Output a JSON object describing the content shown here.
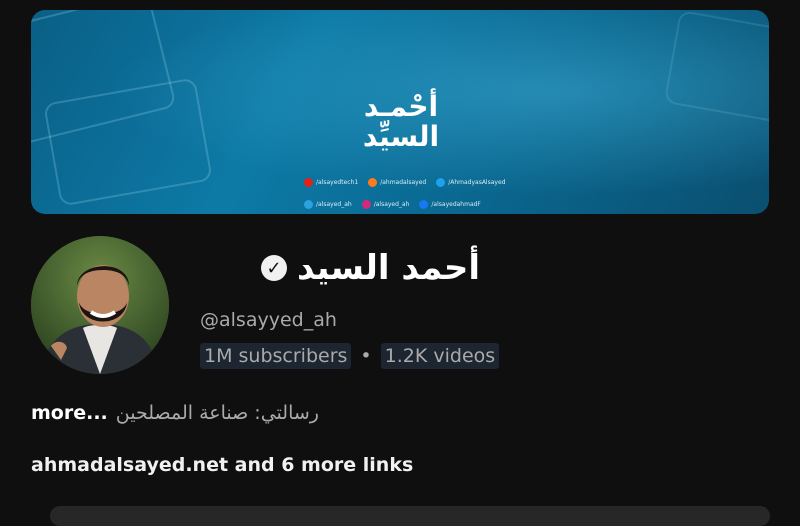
{
  "banner": {
    "title_line1": "أحْمـد",
    "title_line2": "السيِّد",
    "links": [
      {
        "icon": "youtube-icon",
        "color": "#e62117",
        "label": "/alsayedtech1"
      },
      {
        "icon": "soundcloud-icon",
        "color": "#ff7a1a",
        "label": "/ahmadalsayed"
      },
      {
        "icon": "twitter-icon",
        "color": "#1da1f2",
        "label": "/AhmadyasAlsayed"
      },
      {
        "icon": "telegram-icon",
        "color": "#2aa3de",
        "label": "/alsayed_ah"
      },
      {
        "icon": "instagram-icon",
        "color": "#d6287a",
        "label": "/alsayed_ah"
      },
      {
        "icon": "facebook-icon",
        "color": "#1877f2",
        "label": "/alsayedahmadF"
      }
    ]
  },
  "channel": {
    "name": "أحمد السيد",
    "handle": "@alsayyed_ah",
    "subscribers": "1M subscribers",
    "separator": "•",
    "videos": "1.2K videos",
    "description": "رسالتي: صناعة المصلحين",
    "more": "more...",
    "links_text": "ahmadalsayed.net and 6 more links"
  }
}
